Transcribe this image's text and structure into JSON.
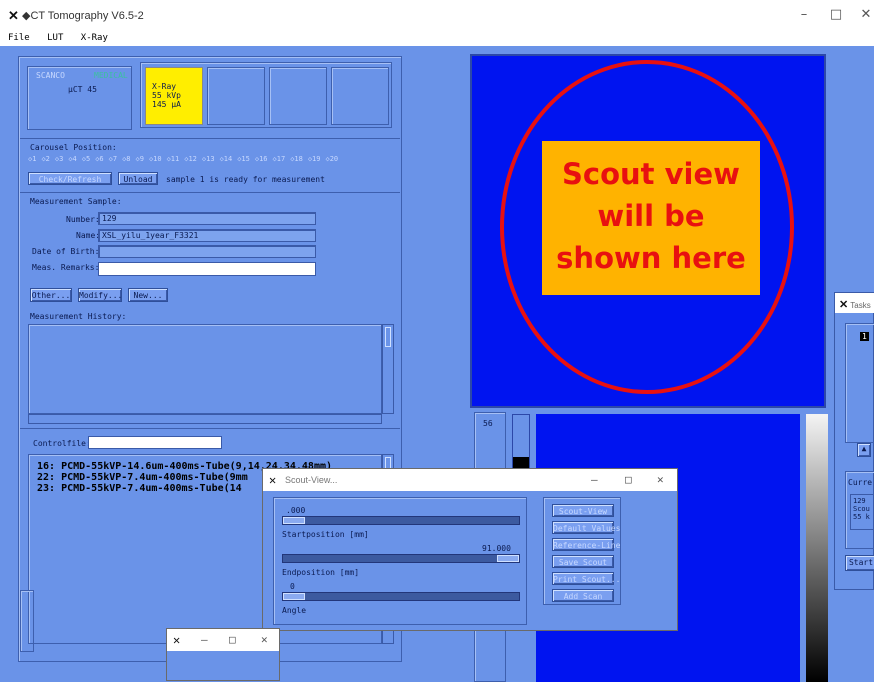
{
  "window": {
    "title": "◆CT Tomography V6.5-2",
    "minimize": "–",
    "maximize": "□",
    "close": "✕"
  },
  "menu": [
    "File",
    "LUT",
    "X-Ray"
  ],
  "brand": {
    "company_left": "SCANCO",
    "company_right": "MEDICAL",
    "model": "µCT 45"
  },
  "xray_status": {
    "line1": "X-Ray",
    "line2": "55 kVp",
    "line3": "145 µA",
    "color": "#ffee00"
  },
  "carousel": {
    "label": "Carousel Position:",
    "positions": [
      "1",
      "2",
      "3",
      "4",
      "5",
      "6",
      "7",
      "8",
      "9",
      "10",
      "11",
      "12",
      "13",
      "14",
      "15",
      "16",
      "17",
      "18",
      "19",
      "20"
    ],
    "check_button": "Check/Refresh",
    "unload_button": "Unload",
    "status": "sample 1 is ready for measurement"
  },
  "sample": {
    "header": "Measurement Sample:",
    "number_label": "Number:",
    "number": "129",
    "name_label": "Name:",
    "name": "XSL_yilu_1year_F3321",
    "dob_label": "Date of Birth:",
    "dob": "",
    "remarks_label": "Meas. Remarks:",
    "remarks": "",
    "other_button": "Other...",
    "modify_button": "Modify...",
    "new_button": "New...",
    "history_label": "Measurement History:"
  },
  "controlfile": {
    "label": "Controlfile:",
    "value": "",
    "entries": [
      "16:  PCMD-55kVP-14.6um-400ms-Tube(9,14,24,34,48mm)",
      "22:  PCMD-55kVP-7.4um-400ms-Tube(9mm",
      "23:  PCMD-55kVP-7.4um-400ms-Tube(14"
    ]
  },
  "scout_overlay": {
    "text": "Scout view will be shown here",
    "bg": "#ffb300",
    "ring": "#e81010",
    "view_bg": "#0014f0"
  },
  "lut": {
    "value": "56"
  },
  "scout_dialog": {
    "title": "Scout-View...",
    "start_value": ".000",
    "start_label": "Startposition [mm]",
    "end_value": "91.000",
    "end_label": "Endposition [mm]",
    "angle_value": "0",
    "angle_label": "Angle",
    "buttons": [
      "Scout-View",
      "Default Values",
      "Reference-Line",
      "Save Scout",
      "Print Scout...",
      "Add Scan"
    ]
  },
  "tasks": {
    "title": "Tasks",
    "badge": "1",
    "current_label": "Curre",
    "info": [
      "129",
      "Scou",
      "55 k"
    ],
    "start_button": "Start"
  }
}
